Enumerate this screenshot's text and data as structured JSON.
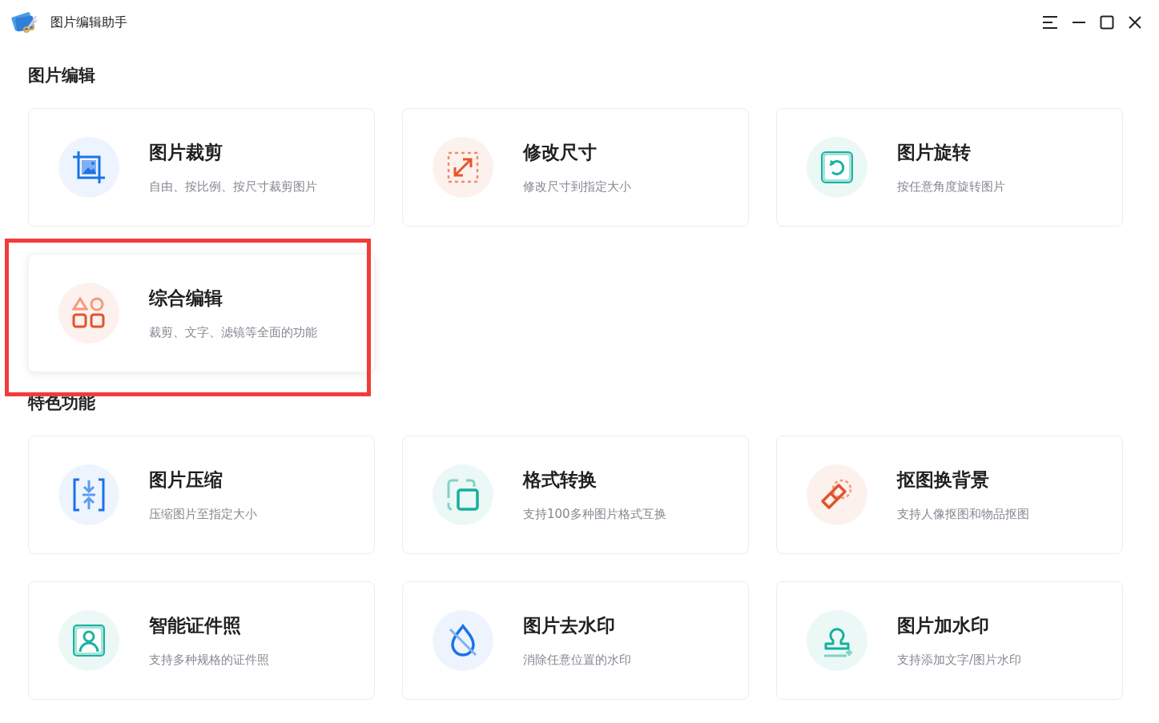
{
  "window": {
    "title": "图片编辑助手"
  },
  "sections": [
    {
      "title": "图片编辑",
      "cards": [
        {
          "title": "图片裁剪",
          "description": "自由、按比例、按尺寸裁剪图片",
          "highlighted": false
        },
        {
          "title": "修改尺寸",
          "description": "修改尺寸到指定大小",
          "highlighted": false
        },
        {
          "title": "图片旋转",
          "description": "按任意角度旋转图片",
          "highlighted": false
        },
        {
          "title": "综合编辑",
          "description": "裁剪、文字、滤镜等全面的功能",
          "highlighted": true
        }
      ]
    },
    {
      "title": "特色功能",
      "cards": [
        {
          "title": "图片压缩",
          "description": "压缩图片至指定大小",
          "highlighted": false
        },
        {
          "title": "格式转换",
          "description": "支持100多种图片格式互换",
          "highlighted": false
        },
        {
          "title": "抠图换背景",
          "description": "支持人像抠图和物品抠图",
          "highlighted": false
        },
        {
          "title": "智能证件照",
          "description": "支持多种规格的证件照",
          "highlighted": false
        },
        {
          "title": "图片去水印",
          "description": "消除任意位置的水印",
          "highlighted": false
        },
        {
          "title": "图片加水印",
          "description": "支持添加文字/图片水印",
          "highlighted": false
        }
      ]
    }
  ]
}
